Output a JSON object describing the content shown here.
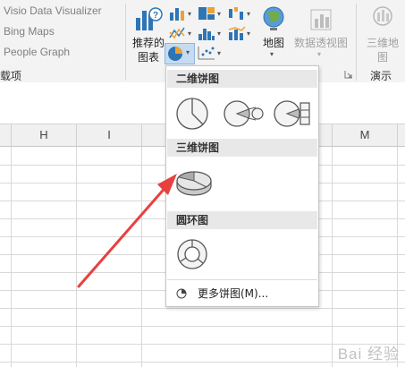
{
  "addins": [
    "Visio Data Visualizer",
    "Bing Maps",
    "People Graph"
  ],
  "addins_group_label": "载项",
  "ribbon": {
    "recommended_charts_line1": "推荐的",
    "recommended_charts_line2": "图表",
    "maps_label": "地图",
    "pivot_chart_label": "数据透视图",
    "threed_map_line1": "三维地",
    "threed_map_line2": "图",
    "tours_group_label": "演示"
  },
  "column_headers": [
    "H",
    "I",
    "M"
  ],
  "dropdown": {
    "section_2d": "二维饼图",
    "section_3d": "三维饼图",
    "section_doughnut": "圆环图",
    "more_label": "更多饼图(M)..."
  },
  "colors": {
    "arrow": "#e8403f",
    "accent": "#2e75b6",
    "ribbon_bg": "#f3f3f3"
  },
  "watermark": "Bai 经验"
}
